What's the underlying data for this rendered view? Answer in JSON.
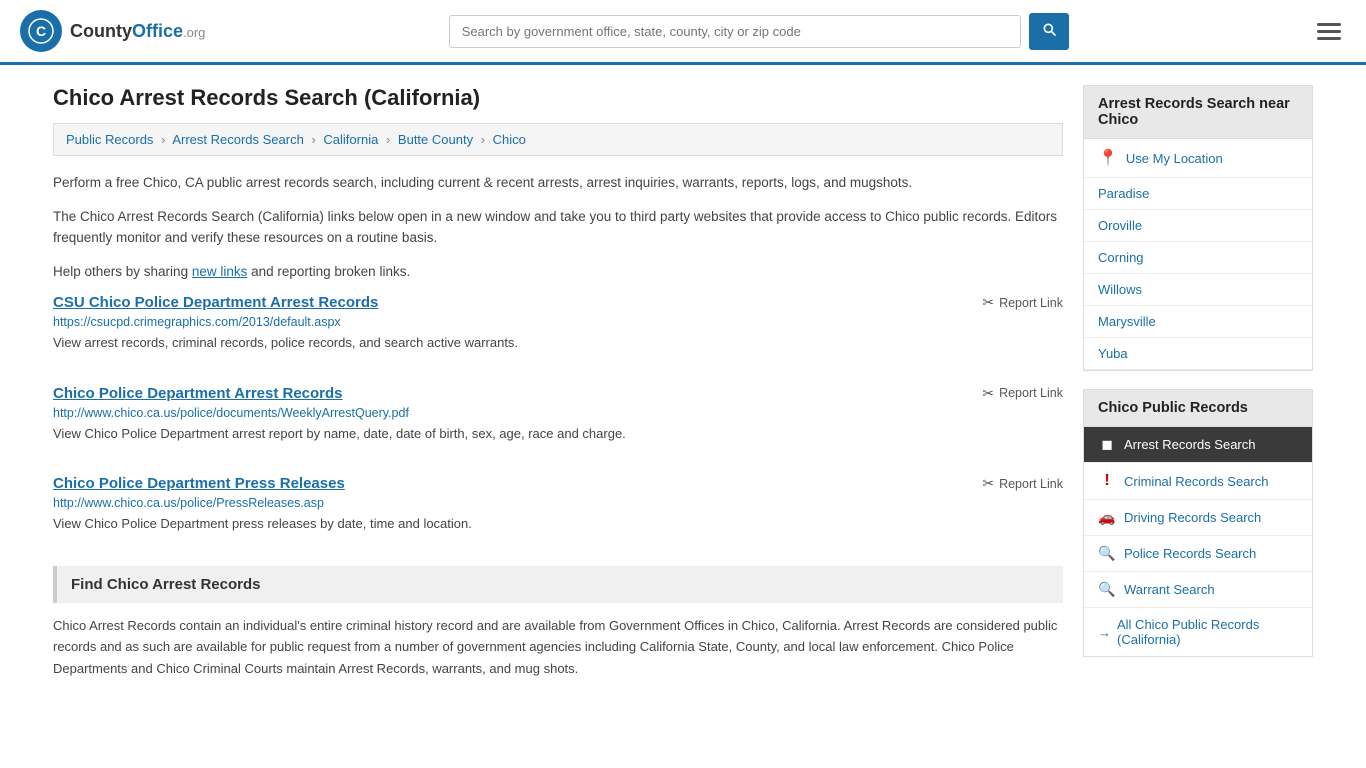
{
  "header": {
    "logo_icon": "🔵",
    "logo_brand": "CountyOffice",
    "logo_org": ".org",
    "search_placeholder": "Search by government office, state, county, city or zip code",
    "search_button_label": "🔍",
    "menu_button_label": "≡"
  },
  "page": {
    "title": "Chico Arrest Records Search (California)",
    "breadcrumb": [
      {
        "label": "Public Records",
        "href": "#"
      },
      {
        "label": "Arrest Records Search",
        "href": "#"
      },
      {
        "label": "California",
        "href": "#"
      },
      {
        "label": "Butte County",
        "href": "#"
      },
      {
        "label": "Chico",
        "href": "#"
      }
    ],
    "description1": "Perform a free Chico, CA public arrest records search, including current & recent arrests, arrest inquiries, warrants, reports, logs, and mugshots.",
    "description2": "The Chico Arrest Records Search (California) links below open in a new window and take you to third party websites that provide access to Chico public records. Editors frequently monitor and verify these resources on a routine basis.",
    "description3_before": "Help others by sharing ",
    "description3_link": "new links",
    "description3_after": " and reporting broken links.",
    "records": [
      {
        "title": "CSU Chico Police Department Arrest Records",
        "url": "https://csucpd.crimegraphics.com/2013/default.aspx",
        "desc": "View arrest records, criminal records, police records, and search active warrants.",
        "report_label": "Report Link"
      },
      {
        "title": "Chico Police Department Arrest Records",
        "url": "http://www.chico.ca.us/police/documents/WeeklyArrestQuery.pdf",
        "desc": "View Chico Police Department arrest report by name, date, date of birth, sex, age, race and charge.",
        "report_label": "Report Link"
      },
      {
        "title": "Chico Police Department Press Releases",
        "url": "http://www.chico.ca.us/police/PressReleases.asp",
        "desc": "View Chico Police Department press releases by date, time and location.",
        "report_label": "Report Link"
      }
    ],
    "find_section_title": "Find Chico Arrest Records",
    "find_section_text": "Chico Arrest Records contain an individual's entire criminal history record and are available from Government Offices in Chico, California. Arrest Records are considered public records and as such are available for public request from a number of government agencies including California State, County, and local law enforcement. Chico Police Departments and Chico Criminal Courts maintain Arrest Records, warrants, and mug shots."
  },
  "sidebar": {
    "nearby_title": "Arrest Records Search near Chico",
    "use_my_location_label": "Use My Location",
    "nearby_cities": [
      {
        "label": "Paradise"
      },
      {
        "label": "Oroville"
      },
      {
        "label": "Corning"
      },
      {
        "label": "Willows"
      },
      {
        "label": "Marysville"
      },
      {
        "label": "Yuba"
      }
    ],
    "public_records_title": "Chico Public Records",
    "public_records_items": [
      {
        "label": "Arrest Records Search",
        "icon": "◼",
        "active": true
      },
      {
        "label": "Criminal Records Search",
        "icon": "!"
      },
      {
        "label": "Driving Records Search",
        "icon": "🚗"
      },
      {
        "label": "Police Records Search",
        "icon": "🔍"
      },
      {
        "label": "Warrant Search",
        "icon": "🔍"
      }
    ],
    "all_records_label": "All Chico Public Records (California)"
  }
}
